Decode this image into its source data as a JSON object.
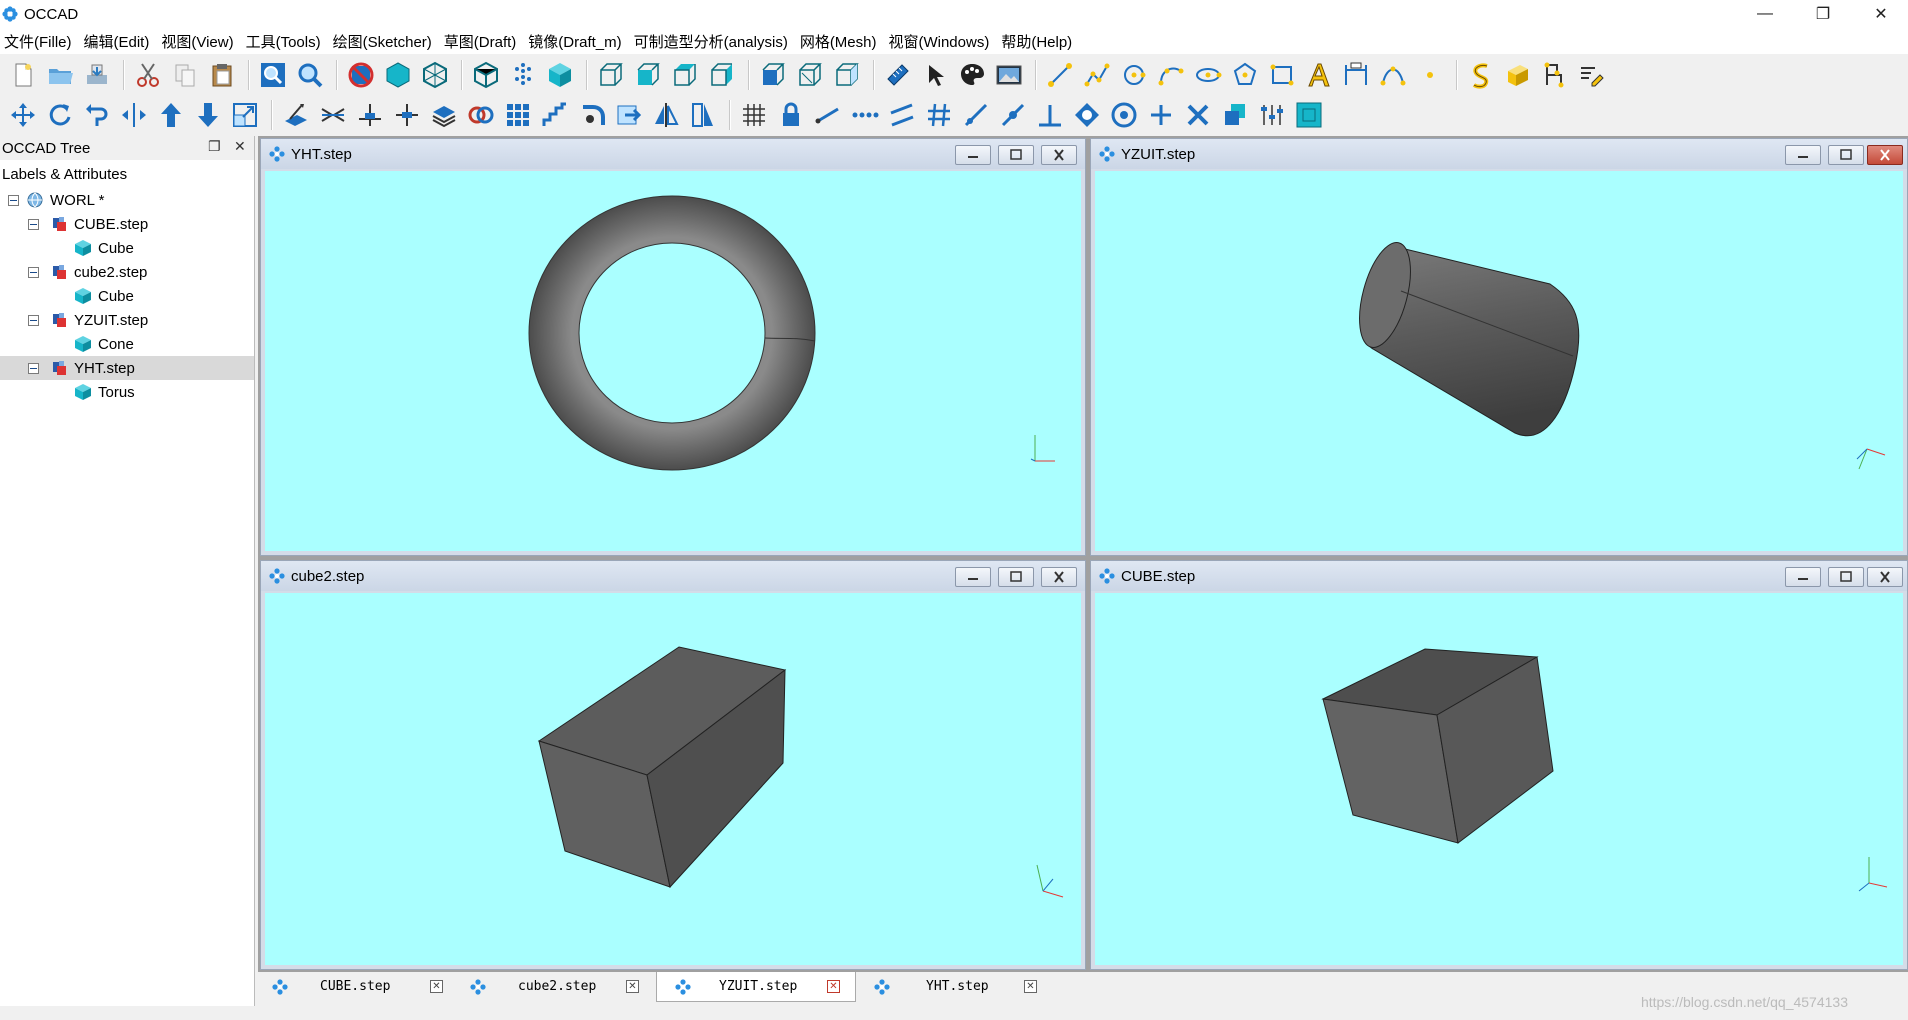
{
  "window": {
    "title": "OCCAD",
    "controls": [
      "—",
      "❐",
      "✕"
    ]
  },
  "menu": [
    "文件(Fille)",
    "编辑(Edit)",
    "视图(View)",
    "工具(Tools)",
    "绘图(Sketcher)",
    "草图(Draft)",
    "镜像(Draft_m)",
    "可制造型分析(analysis)",
    "网格(Mesh)",
    "视窗(Windows)",
    "帮助(Help)"
  ],
  "toolbar1": [
    "new-file",
    "open-folder",
    "save",
    "cut",
    "copy",
    "paste",
    "zoom-window",
    "zoom-fit",
    "no-display",
    "shaded",
    "wireframe",
    "hidden-line",
    "points",
    "solid-cube",
    "view-front",
    "view-back",
    "view-top",
    "view-bottom",
    "view-left",
    "view-right",
    "view-iso",
    "measure",
    "select-arrow",
    "palette",
    "image",
    "line",
    "polyline",
    "circle",
    "arc",
    "ellipse",
    "polygon",
    "rectangle",
    "text",
    "dimension",
    "bezier",
    "point",
    "spline",
    "face",
    "skeleton",
    "edit"
  ],
  "toolbar2": [
    "move",
    "rotate",
    "rotate-ccw",
    "mirror",
    "move-up",
    "move-down",
    "scale",
    "extrude",
    "trim",
    "split-plus",
    "split-minus",
    "layers",
    "boolean",
    "array",
    "stairs",
    "fillet",
    "export",
    "symmetry",
    "wedge",
    "grid",
    "lock",
    "link",
    "dots",
    "parallel",
    "hash",
    "line-tool",
    "offset",
    "perpendicular",
    "hexagon-target",
    "circle-target",
    "plus",
    "cross",
    "copy-shape",
    "constraint",
    "snap-box"
  ],
  "tree": {
    "dock_title": "OCCAD Tree",
    "header": "Labels & Attributes",
    "nodes": [
      {
        "label": "WORL *",
        "level": 0,
        "icon": "globe-icon"
      },
      {
        "label": "CUBE.step",
        "level": 1,
        "icon": "assembly-icon"
      },
      {
        "label": "Cube",
        "level": 2,
        "icon": "cube-icon"
      },
      {
        "label": "cube2.step",
        "level": 1,
        "icon": "assembly-icon"
      },
      {
        "label": "Cube",
        "level": 2,
        "icon": "cube-icon"
      },
      {
        "label": "YZUIT.step",
        "level": 1,
        "icon": "assembly-icon"
      },
      {
        "label": "Cone",
        "level": 2,
        "icon": "cube-icon"
      },
      {
        "label": "YHT.step",
        "level": 1,
        "icon": "assembly-icon",
        "selected": true
      },
      {
        "label": "Torus",
        "level": 2,
        "icon": "cube-icon"
      }
    ]
  },
  "subwindows": [
    {
      "title": "YHT.step",
      "shape": "torus"
    },
    {
      "title": "YZUIT.step",
      "shape": "cone"
    },
    {
      "title": "cube2.step",
      "shape": "box"
    },
    {
      "title": "CUBE.step",
      "shape": "cube"
    }
  ],
  "tabs": [
    {
      "label": "CUBE.step"
    },
    {
      "label": "cube2.step"
    },
    {
      "label": "YZUIT.step",
      "active": true
    },
    {
      "label": "YHT.step"
    }
  ],
  "watermark": "https://blog.csdn.net/qq_4574133",
  "colors": {
    "viewport": "#aaffff",
    "shape": "#5f5f5f",
    "accent": "#1e90ff"
  }
}
